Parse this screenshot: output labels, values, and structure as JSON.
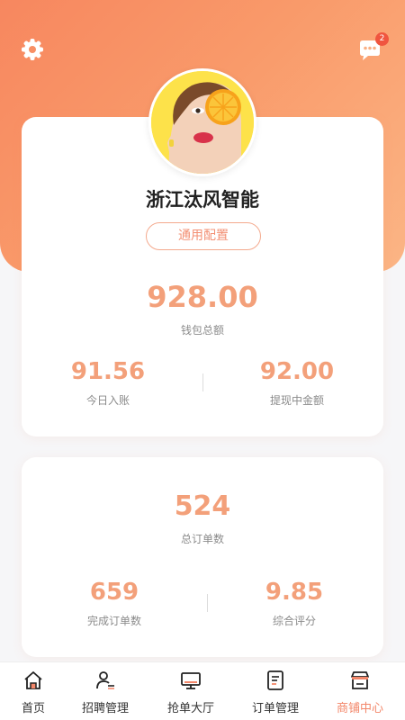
{
  "header": {
    "message_badge": "2"
  },
  "profile": {
    "shop_name": "浙江汰风智能",
    "config_button_label": "通用配置"
  },
  "wallet": {
    "total_value": "928.00",
    "total_label": "钱包总额",
    "today_value": "91.56",
    "today_label": "今日入账",
    "withdrawing_value": "92.00",
    "withdrawing_label": "提现中金额"
  },
  "orders": {
    "total_value": "524",
    "total_label": "总订单数",
    "completed_value": "659",
    "completed_label": "完成订单数",
    "rating_value": "9.85",
    "rating_label": "综合评分"
  },
  "tabbar": {
    "items": [
      {
        "label": "首页",
        "icon": "home-icon",
        "active": false
      },
      {
        "label": "招聘管理",
        "icon": "recruit-icon",
        "active": false
      },
      {
        "label": "抢单大厅",
        "icon": "monitor-icon",
        "active": false
      },
      {
        "label": "订单管理",
        "icon": "document-icon",
        "active": false
      },
      {
        "label": "商铺中心",
        "icon": "store-icon",
        "active": true
      }
    ]
  },
  "colors": {
    "accent": "#f3876a",
    "value_text": "#f3a07a",
    "header_gradient_start": "#f7875f",
    "header_gradient_end": "#fbb585"
  }
}
